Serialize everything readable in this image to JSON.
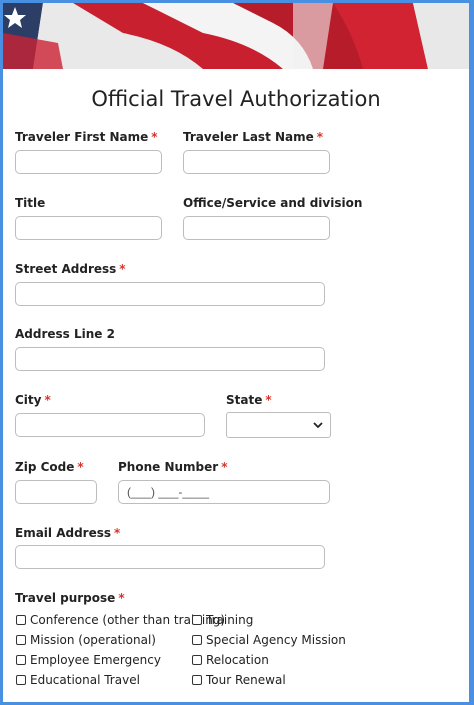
{
  "form": {
    "title": "Official Travel Authorization",
    "first_name_label": "Traveler First Name",
    "last_name_label": "Traveler Last Name",
    "title_label": "Title",
    "office_label": "Office/Service and division",
    "street_label": "Street Address",
    "address2_label": "Address Line 2",
    "city_label": "City",
    "state_label": "State",
    "zip_label": "Zip Code",
    "phone_label": "Phone Number",
    "phone_placeholder": "(___) ___-____",
    "email_label": "Email Address",
    "purpose_label": "Travel purpose",
    "required_mark": "*",
    "purpose_options": [
      "Conference (other than training)",
      "Training",
      "Mission (operational)",
      "Special Agency Mission",
      "Employee Emergency",
      "Relocation",
      "Educational Travel",
      "Tour Renewal"
    ]
  },
  "colors": {
    "frame_border": "#4a90e2",
    "required": "#d9342b"
  }
}
